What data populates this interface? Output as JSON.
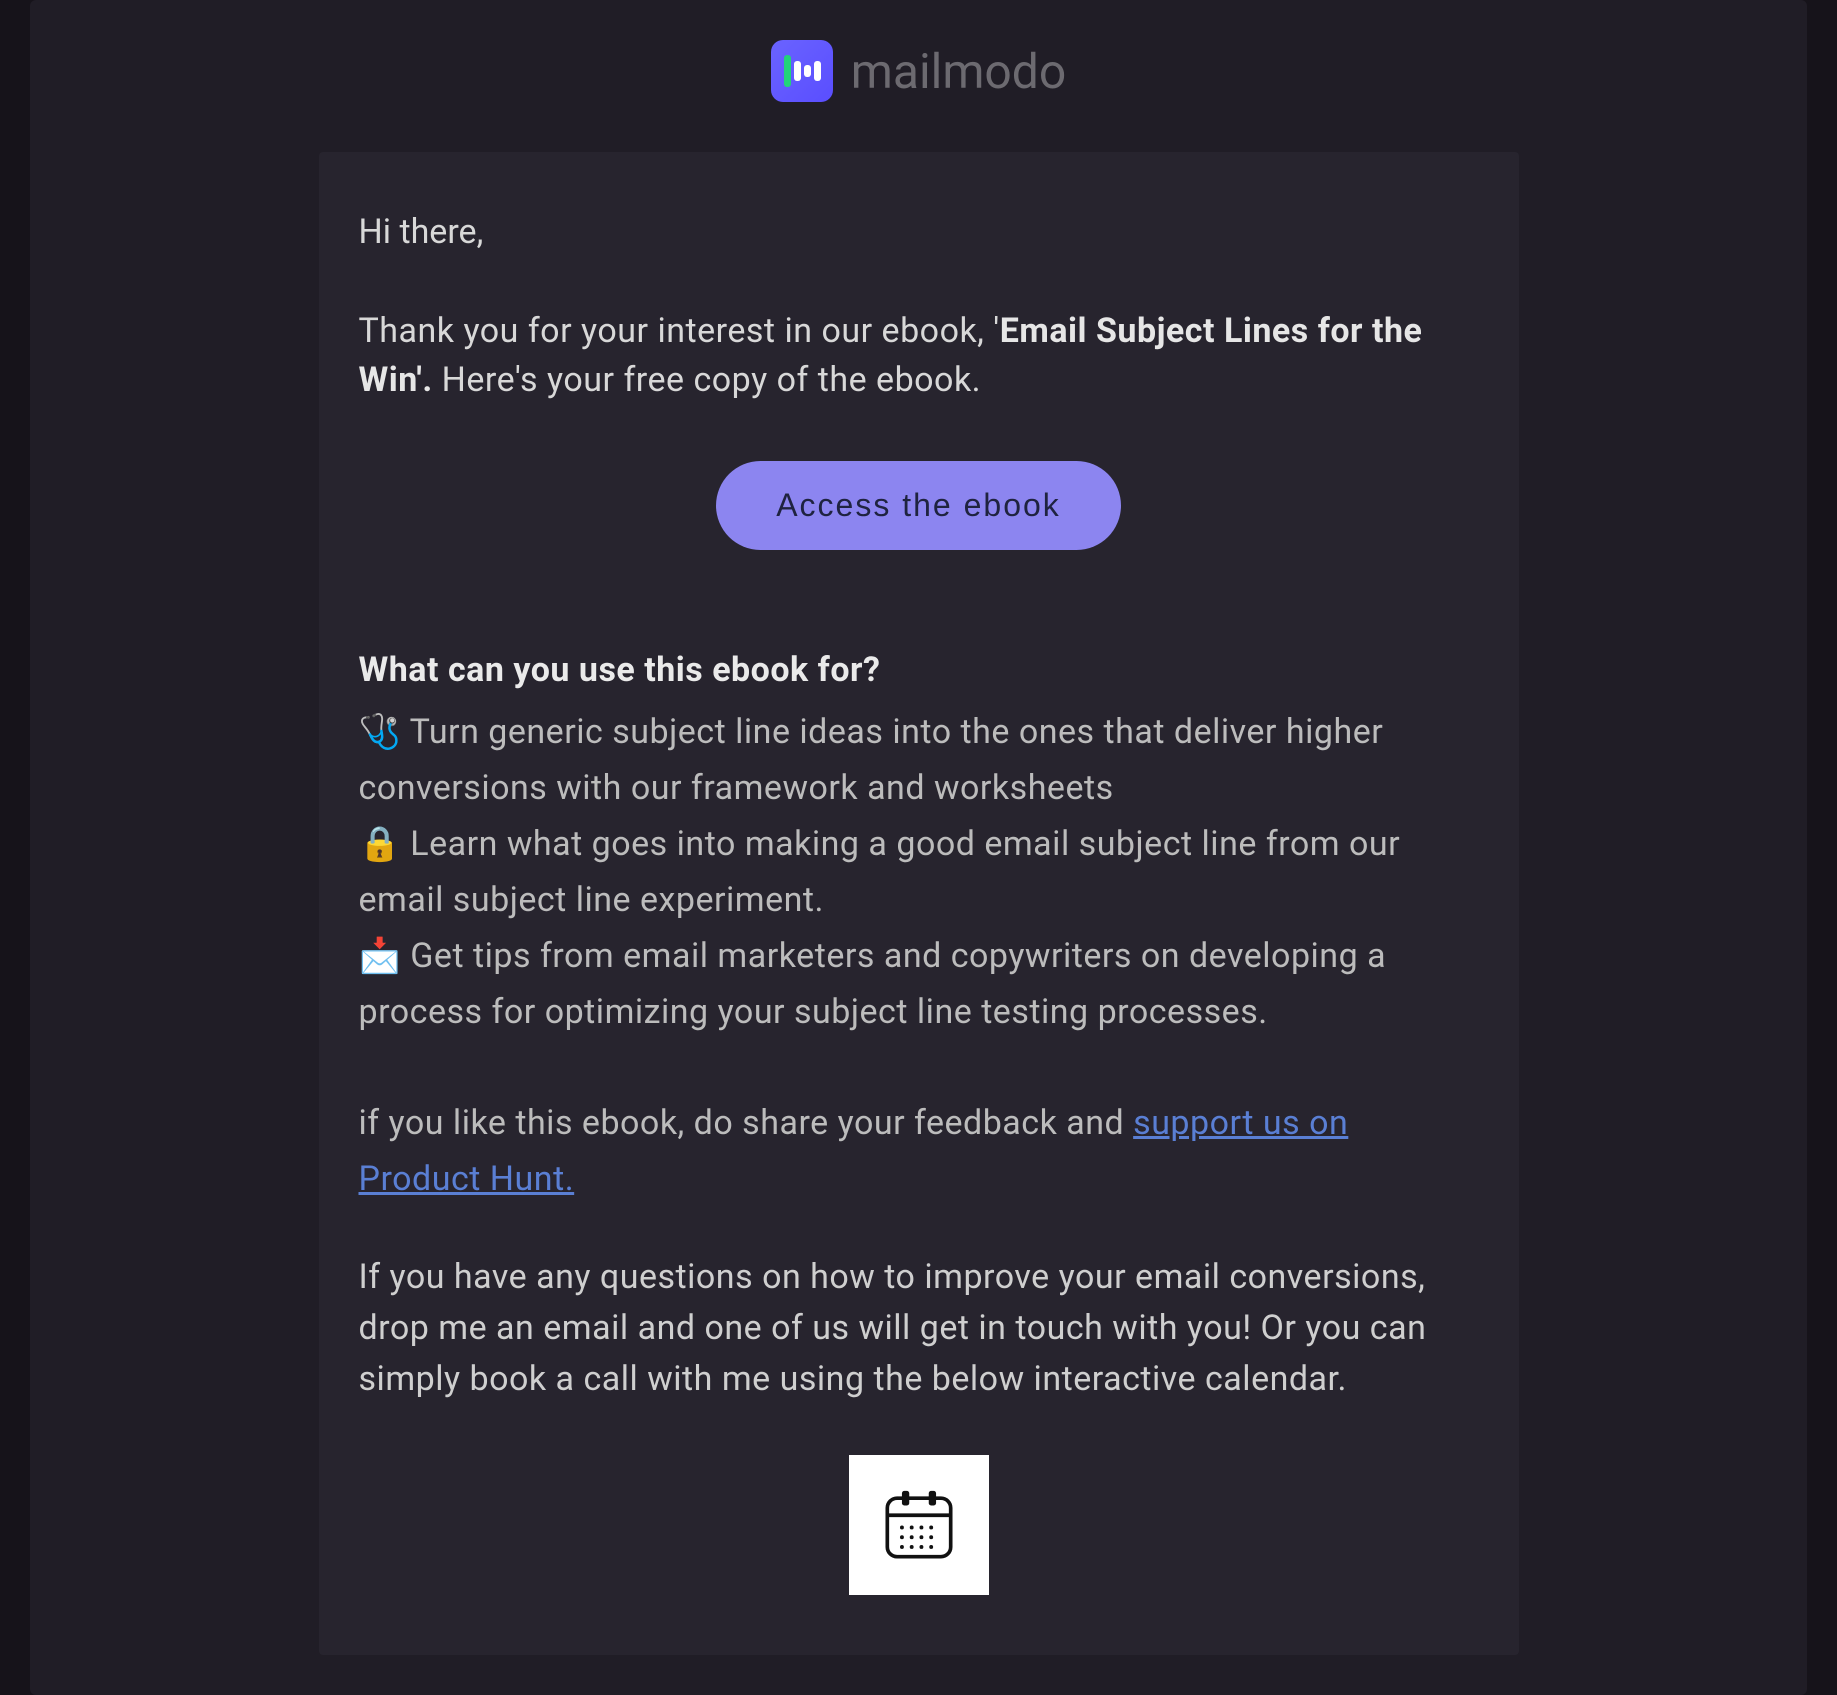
{
  "brand": {
    "name": "mailmodo"
  },
  "email": {
    "greeting": "Hi there,",
    "intro_prefix": "Thank you for your interest in our ebook, '",
    "intro_bold": "Email Subject Lines for the Win'.",
    "intro_suffix": " Here's your free copy of the ebook.",
    "cta_label": "Access the ebook",
    "section_heading": "What can you use this ebook for?",
    "bullets": [
      "🩺 Turn generic subject line ideas into the ones that deliver higher conversions with our framework and worksheets",
      "🔒 Learn what goes into making a good email subject line from our email subject line experiment.",
      "📩 Get tips from email marketers and copywriters on developing a process for optimizing your subject line testing processes."
    ],
    "feedback_prefix": "if you like this ebook, do share your feedback and ",
    "feedback_link_text": "support us on Product Hunt. ",
    "closing": "If you have any questions on how to improve your email conversions, drop me an email and one of us will get in touch with you! Or you can simply book a call with me using the below interactive calendar."
  }
}
